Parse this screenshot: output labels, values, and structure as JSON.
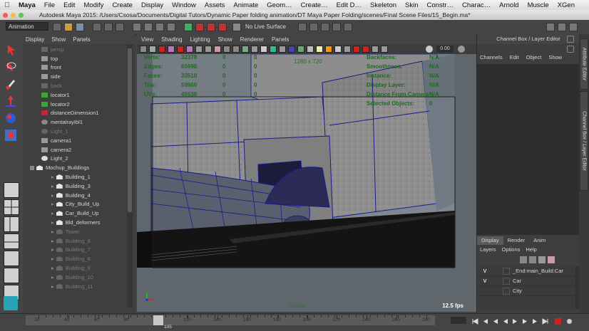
{
  "menubar": {
    "app": "Maya",
    "items": [
      "File",
      "Edit",
      "Modify",
      "Create",
      "Display",
      "Window",
      "Assets",
      "Animate",
      "Geom…",
      "Create…",
      "Edit D…",
      "Skeleton",
      "Skin",
      "Constr…",
      "Charac…",
      "Arnold",
      "Muscle",
      "XGen"
    ]
  },
  "window": {
    "title": "Autodesk Maya 2015: /Users/Csosa/Documents/Digital Tutors/Dynamic Paper folding animation/DT Maya Paper Folding/scenes/Final Scene Files/15_Begin.ma*"
  },
  "status_line": {
    "menu_set": "Animation",
    "live_surface": "No Live Surface"
  },
  "outliner": {
    "menu": [
      "Display",
      "Show",
      "Panels"
    ],
    "rows": [
      {
        "label": "persp",
        "icon": "camera-icon",
        "dim": true,
        "indent": 1
      },
      {
        "label": "top",
        "icon": "camera-icon",
        "dim": false,
        "indent": 1
      },
      {
        "label": "front",
        "icon": "camera-icon",
        "dim": false,
        "indent": 1
      },
      {
        "label": "side",
        "icon": "camera-icon",
        "dim": false,
        "indent": 1
      },
      {
        "label": "back",
        "icon": "camera-icon",
        "dim": true,
        "indent": 1
      },
      {
        "label": "locator1",
        "icon": "locator-icon",
        "dim": false,
        "indent": 1
      },
      {
        "label": "locator2",
        "icon": "locator-icon",
        "dim": false,
        "indent": 1
      },
      {
        "label": "distanceDimension1",
        "icon": "dimension-icon",
        "dim": false,
        "indent": 1
      },
      {
        "label": "mentalrayIbl1",
        "icon": "sphere-icon",
        "dim": false,
        "indent": 1
      },
      {
        "label": "Light_1",
        "icon": "light-icon",
        "dim": true,
        "indent": 1
      },
      {
        "label": "camera1",
        "icon": "camera-icon",
        "dim": false,
        "indent": 1
      },
      {
        "label": "camera2",
        "icon": "camera-icon",
        "dim": false,
        "indent": 1
      },
      {
        "label": "Light_2",
        "icon": "light-icon",
        "dim": false,
        "indent": 1
      },
      {
        "label": "Mochup_Buildings",
        "icon": "group-icon",
        "dim": false,
        "indent": 0
      },
      {
        "label": "Building_1",
        "icon": "group-icon",
        "dim": false,
        "indent": 2
      },
      {
        "label": "Building_3",
        "icon": "group-icon",
        "dim": false,
        "indent": 2
      },
      {
        "label": "Building_4",
        "icon": "group-icon",
        "dim": false,
        "indent": 2
      },
      {
        "label": "City_Build_Up",
        "icon": "group-icon",
        "dim": false,
        "indent": 2
      },
      {
        "label": "Car_Build_Up",
        "icon": "group-icon",
        "dim": false,
        "indent": 2
      },
      {
        "label": "Bld_deformers",
        "icon": "group-icon",
        "dim": false,
        "indent": 2
      },
      {
        "label": "Tower",
        "icon": "group-icon",
        "dim": true,
        "indent": 2
      },
      {
        "label": "Building_6",
        "icon": "group-icon",
        "dim": true,
        "indent": 2
      },
      {
        "label": "Building_7",
        "icon": "group-icon",
        "dim": true,
        "indent": 2
      },
      {
        "label": "Building_8",
        "icon": "group-icon",
        "dim": true,
        "indent": 2
      },
      {
        "label": "Building_9",
        "icon": "group-icon",
        "dim": true,
        "indent": 2
      },
      {
        "label": "Building_10",
        "icon": "group-icon",
        "dim": true,
        "indent": 2
      },
      {
        "label": "Building_11",
        "icon": "group-icon",
        "dim": true,
        "indent": 2
      }
    ]
  },
  "viewport": {
    "menu": [
      "View",
      "Shading",
      "Lighting",
      "Show",
      "Renderer",
      "Panels"
    ],
    "exposure": "0.00",
    "hud_stats": [
      {
        "label": "Verts:",
        "a": "32378",
        "b": "0",
        "c": "0"
      },
      {
        "label": "Edges:",
        "a": "65698",
        "b": "0",
        "c": "0"
      },
      {
        "label": "Faces:",
        "a": "33510",
        "b": "0",
        "c": "0"
      },
      {
        "label": "Tris:",
        "a": "59960",
        "b": "0",
        "c": "0"
      },
      {
        "label": "UVs:",
        "a": "46538",
        "b": "0",
        "c": "0"
      }
    ],
    "resolution": "1280 x 720",
    "hud_info": [
      {
        "label": "Backfaces:",
        "value": "N/A"
      },
      {
        "label": "Smoothness:",
        "value": "N/A"
      },
      {
        "label": "Instance:",
        "value": "N/A"
      },
      {
        "label": "Display Layer:",
        "value": "N/A"
      },
      {
        "label": "Distance From Camera:",
        "value": "N/A"
      },
      {
        "label": "Selected Objects:",
        "value": "0"
      }
    ],
    "fps": "12.5 fps",
    "camera": "camera2"
  },
  "channel_box": {
    "title": "Channel Box / Layer Editor",
    "menu": [
      "Channels",
      "Edit",
      "Object",
      "Show"
    ]
  },
  "layer_editor": {
    "tabs": [
      "Display",
      "Render",
      "Anim"
    ],
    "active_tab": "Display",
    "menu": [
      "Layers",
      "Options",
      "Help"
    ],
    "layers": [
      {
        "v": "V",
        "p": "",
        "name": "_End:main_Build:Car"
      },
      {
        "v": "V",
        "p": "",
        "name": "Car"
      },
      {
        "v": "",
        "p": "",
        "name": "City"
      }
    ]
  },
  "side_tabs": [
    "Attribute Editor",
    "Channel Box / Layer Editor"
  ],
  "time_slider": {
    "ticks": [
      "20",
      "40",
      "60",
      "80",
      "100",
      "120",
      "140",
      "160",
      "180",
      "200",
      "220",
      "240",
      "260",
      "280"
    ],
    "current_frame": "105"
  },
  "colors": {
    "wire": "#1a1a8c",
    "hud_text": "#1f6a1f",
    "accent_red": "#cc2222"
  }
}
